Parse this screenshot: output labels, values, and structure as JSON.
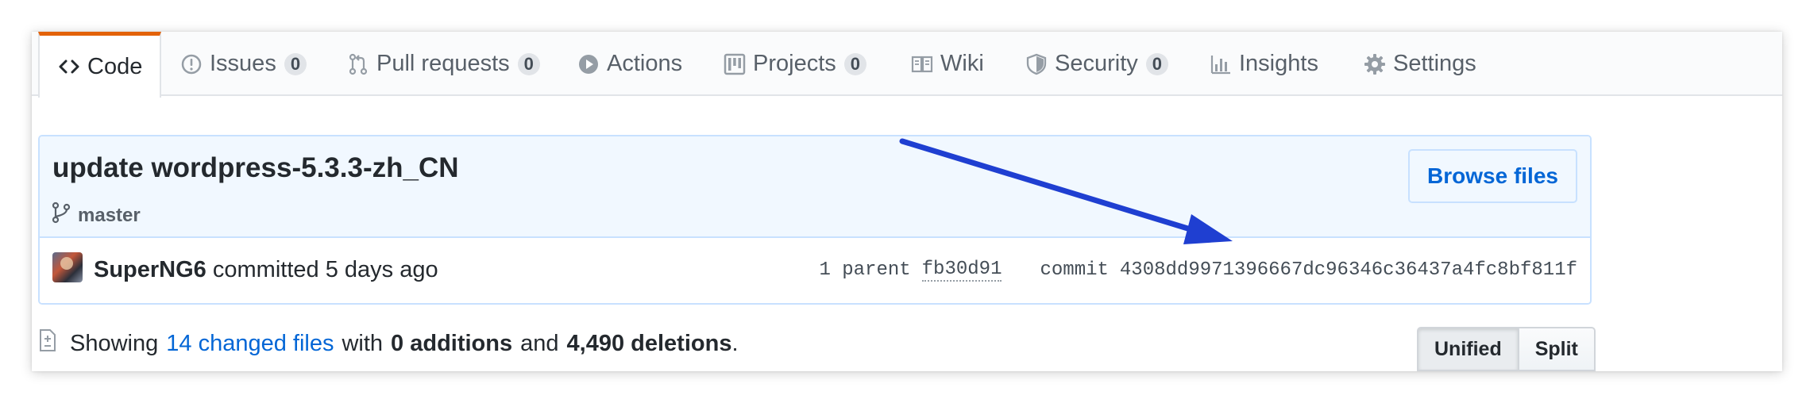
{
  "tabs": [
    {
      "label": "Code",
      "icon": "code-icon"
    },
    {
      "label": "Issues",
      "count": "0",
      "icon": "issue-icon"
    },
    {
      "label": "Pull requests",
      "count": "0",
      "icon": "pull-request-icon"
    },
    {
      "label": "Actions",
      "icon": "play-icon"
    },
    {
      "label": "Projects",
      "count": "0",
      "icon": "project-icon"
    },
    {
      "label": "Wiki",
      "icon": "book-icon"
    },
    {
      "label": "Security",
      "count": "0",
      "icon": "shield-icon"
    },
    {
      "label": "Insights",
      "icon": "graph-icon"
    },
    {
      "label": "Settings",
      "icon": "gear-icon"
    }
  ],
  "commit": {
    "title": "update wordpress-5.3.3-zh_CN",
    "branch": "master",
    "browse_label": "Browse files",
    "author": "SuperNG6",
    "committed_text": "committed 5 days ago",
    "parent_label": "1 parent",
    "parent_sha": "fb30d91",
    "commit_label": "commit",
    "commit_sha": "4308dd9971396667dc96346c36437a4fc8bf811f"
  },
  "toc": {
    "showing": "Showing",
    "changed_files": "14 changed files",
    "with": "with",
    "additions": "0 additions",
    "and": "and",
    "deletions": "4,490 deletions",
    "period": "."
  },
  "view_toggle": {
    "unified": "Unified",
    "split": "Split"
  },
  "colors": {
    "accent": "#e36209",
    "link": "#0366d6",
    "arrow": "#1f3fd1",
    "commit_bg": "#f1f8ff",
    "commit_border": "#c8e1ff"
  }
}
